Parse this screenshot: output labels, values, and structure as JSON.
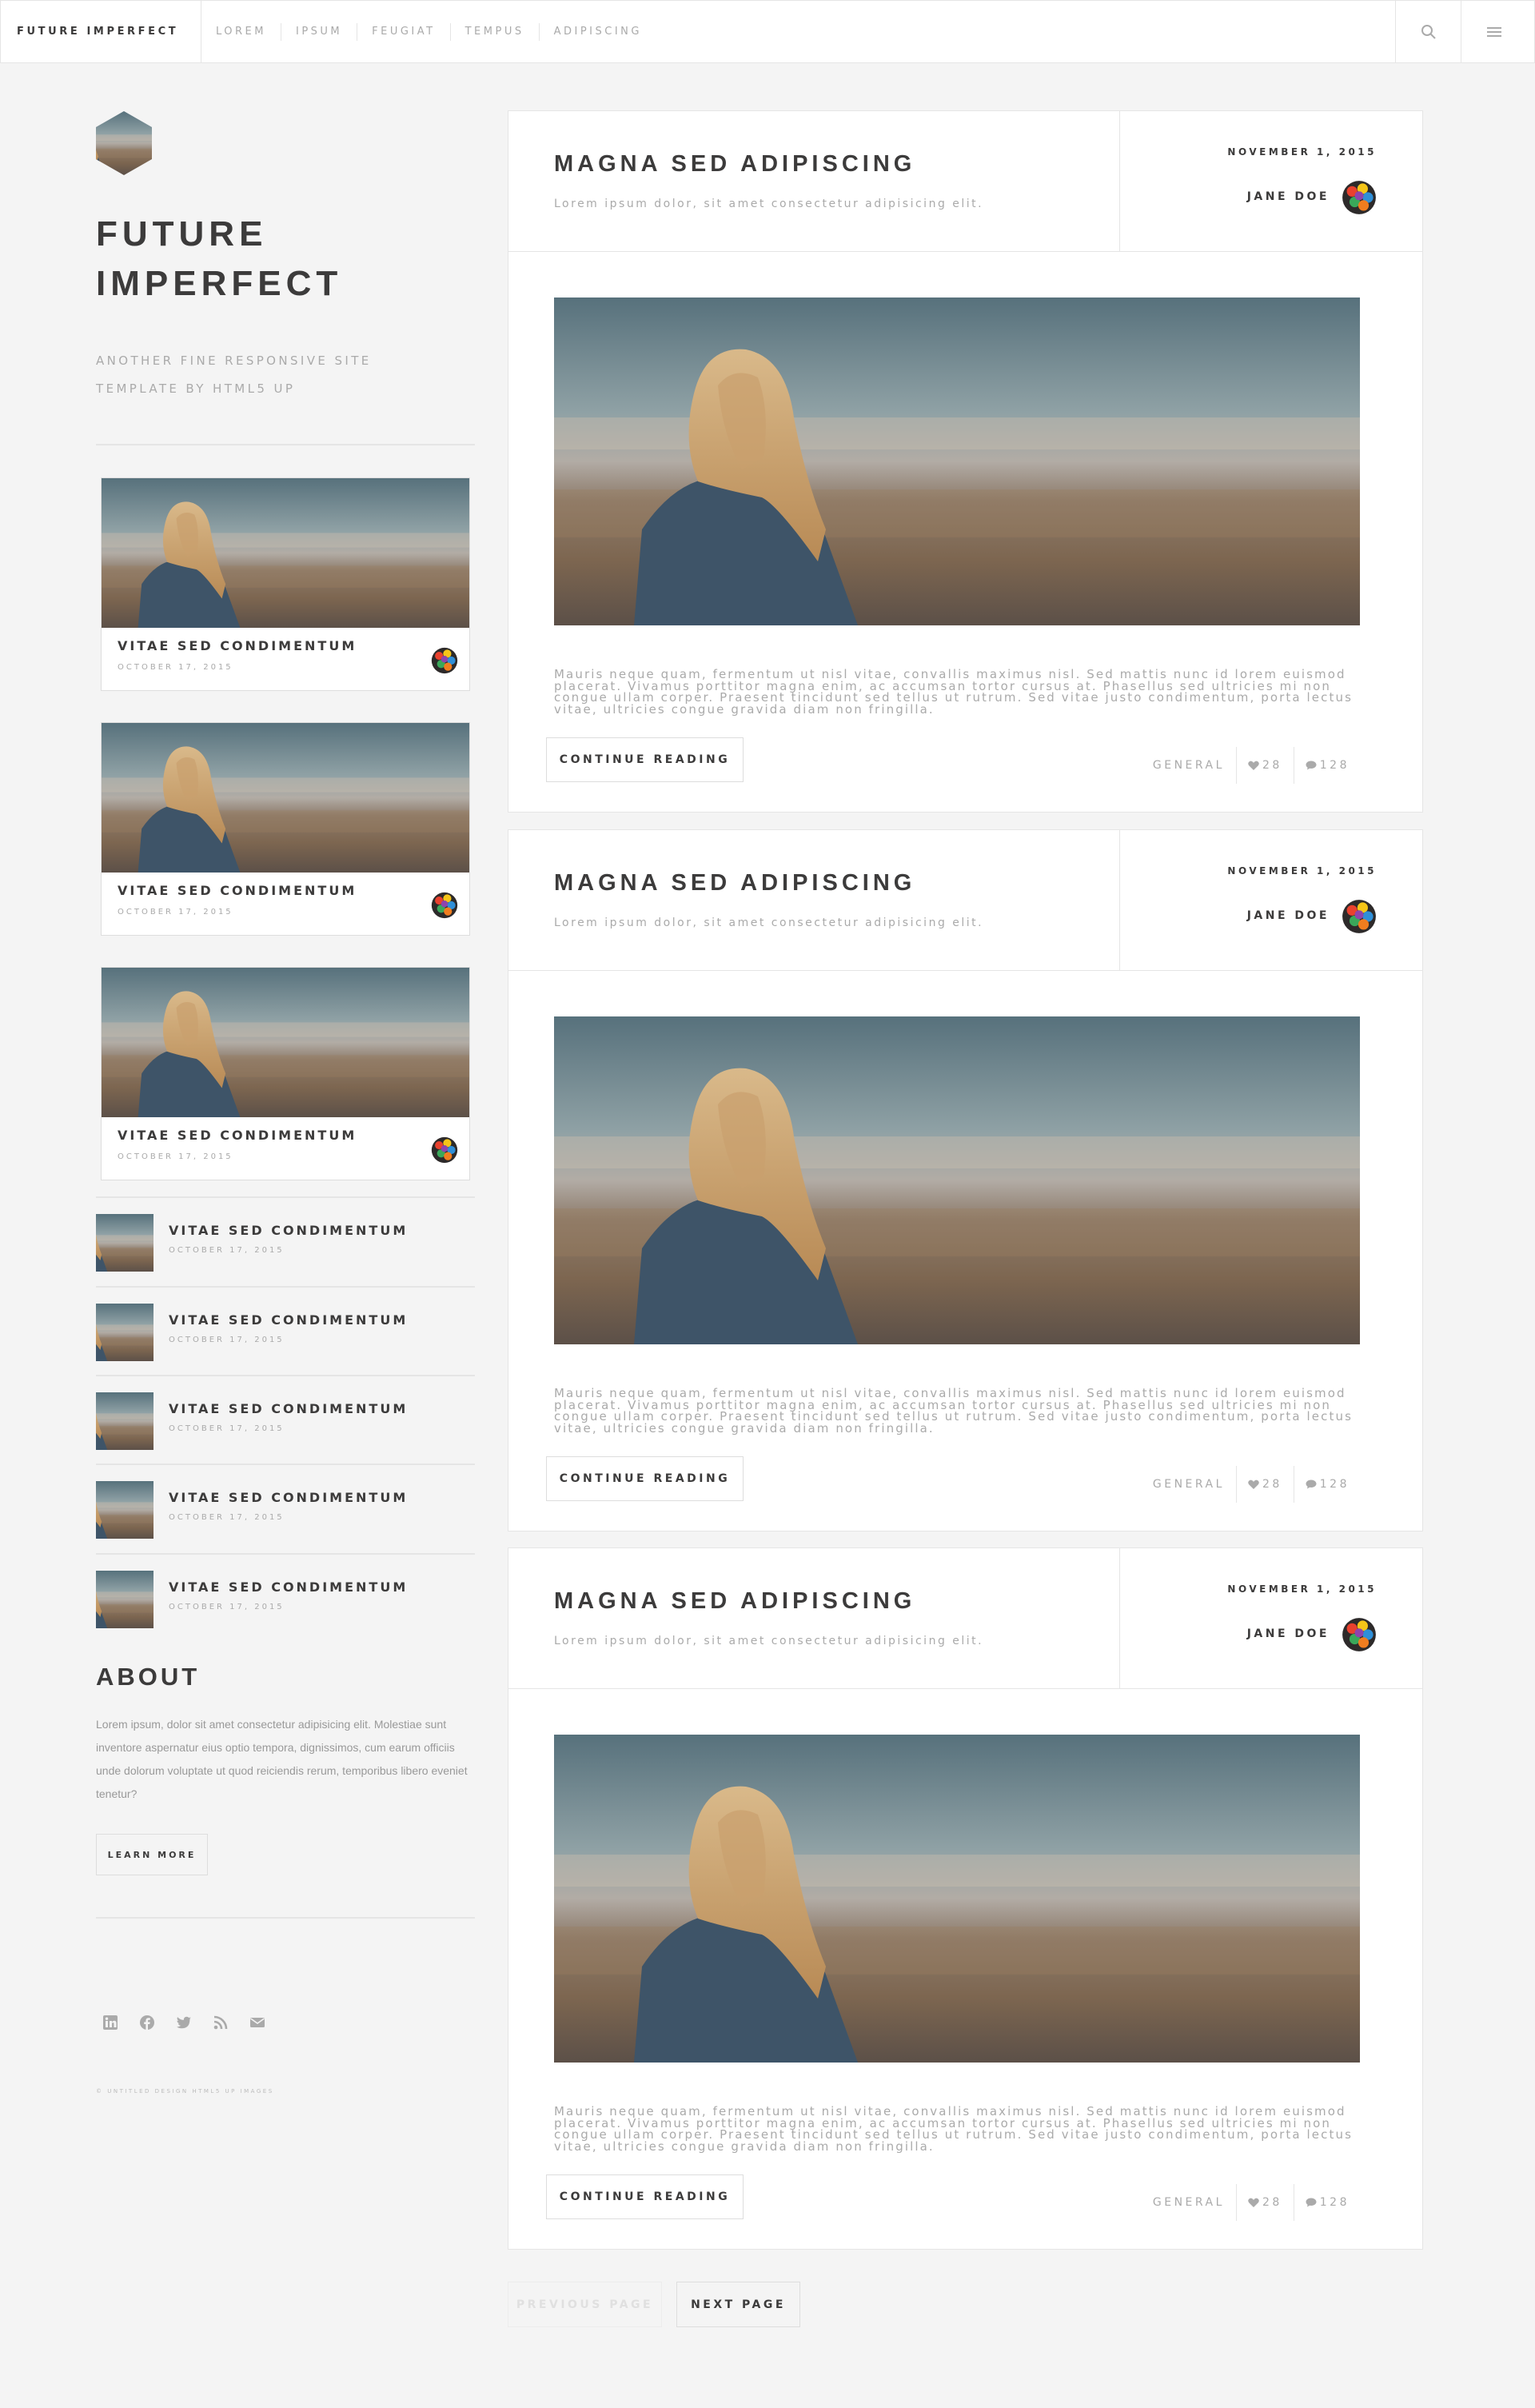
{
  "header": {
    "logo": "FUTURE IMPERFECT",
    "nav": [
      "LOREM",
      "IPSUM",
      "FEUGIAT",
      "TEMPUS",
      "ADIPISCING"
    ],
    "search_icon": "search-icon",
    "menu_icon": "menu-icon"
  },
  "intro": {
    "title": "FUTURE IMPERFECT",
    "subtitle": "ANOTHER FINE RESPONSIVE SITE TEMPLATE BY HTML5 UP"
  },
  "mini_posts": [
    {
      "title": "VITAE SED CONDIMENTUM",
      "date": "OCTOBER 17, 2015"
    },
    {
      "title": "VITAE SED CONDIMENTUM",
      "date": "OCTOBER 17, 2015"
    },
    {
      "title": "VITAE SED CONDIMENTUM",
      "date": "OCTOBER 17, 2015"
    }
  ],
  "post_list": [
    {
      "title": "VITAE SED CONDIMENTUM",
      "date": "OCTOBER 17, 2015"
    },
    {
      "title": "VITAE SED CONDIMENTUM",
      "date": "OCTOBER 17, 2015"
    },
    {
      "title": "VITAE SED CONDIMENTUM",
      "date": "OCTOBER 17, 2015"
    },
    {
      "title": "VITAE SED CONDIMENTUM",
      "date": "OCTOBER 17, 2015"
    },
    {
      "title": "VITAE SED CONDIMENTUM",
      "date": "OCTOBER 17, 2015"
    }
  ],
  "about": {
    "title": "ABOUT",
    "text": "Lorem ipsum, dolor sit amet consectetur adipisicing elit. Molestiae sunt inventore aspernatur eius optio tempora, dignissimos, cum earum officiis unde dolorum voluptate ut quod reiciendis rerum, temporibus libero eveniet tenetur?",
    "button": "LEARN MORE"
  },
  "social_icons": [
    "linkedin-icon",
    "facebook-icon",
    "twitter-icon",
    "rss-icon",
    "email-icon"
  ],
  "copyright": "© UNTITLED DESIGN HTML5 UP IMAGES",
  "posts": [
    {
      "title": "MAGNA SED ADIPISCING",
      "subtitle": "Lorem ipsum dolor, sit amet consectetur adipisicing elit.",
      "date": "NOVEMBER 1, 2015",
      "author": "JANE DOE",
      "excerpt": "Mauris neque quam, fermentum ut nisl vitae, convallis maximus nisl. Sed mattis nunc id lorem euismod placerat. Vivamus porttitor magna enim, ac accumsan tortor cursus at. Phasellus sed ultricies mi non congue ullam corper. Praesent tincidunt sed tellus ut rutrum. Sed vitae justo condimentum, porta lectus vitae, ultricies congue gravida diam non fringilla.",
      "button": "CONTINUE READING",
      "category": "GENERAL",
      "likes": "28",
      "comments": "128"
    },
    {
      "title": "MAGNA SED ADIPISCING",
      "subtitle": "Lorem ipsum dolor, sit amet consectetur adipisicing elit.",
      "date": "NOVEMBER 1, 2015",
      "author": "JANE DOE",
      "excerpt": "Mauris neque quam, fermentum ut nisl vitae, convallis maximus nisl. Sed mattis nunc id lorem euismod placerat. Vivamus porttitor magna enim, ac accumsan tortor cursus at. Phasellus sed ultricies mi non congue ullam corper. Praesent tincidunt sed tellus ut rutrum. Sed vitae justo condimentum, porta lectus vitae, ultricies congue gravida diam non fringilla.",
      "button": "CONTINUE READING",
      "category": "GENERAL",
      "likes": "28",
      "comments": "128"
    },
    {
      "title": "MAGNA SED ADIPISCING",
      "subtitle": "Lorem ipsum dolor, sit amet consectetur adipisicing elit.",
      "date": "NOVEMBER 1, 2015",
      "author": "JANE DOE",
      "excerpt": "Mauris neque quam, fermentum ut nisl vitae, convallis maximus nisl. Sed mattis nunc id lorem euismod placerat. Vivamus porttitor magna enim, ac accumsan tortor cursus at. Phasellus sed ultricies mi non congue ullam corper. Praesent tincidunt sed tellus ut rutrum. Sed vitae justo condimentum, porta lectus vitae, ultricies congue gravida diam non fringilla.",
      "button": "CONTINUE READING",
      "category": "GENERAL",
      "likes": "28",
      "comments": "128"
    }
  ],
  "pagination": {
    "prev": "PREVIOUS PAGE",
    "next": "NEXT PAGE"
  },
  "colors": {
    "background": "#f4f4f4",
    "text": "#3c3b3b",
    "muted": "#aaaaaa",
    "border": "#e5e5e5"
  }
}
